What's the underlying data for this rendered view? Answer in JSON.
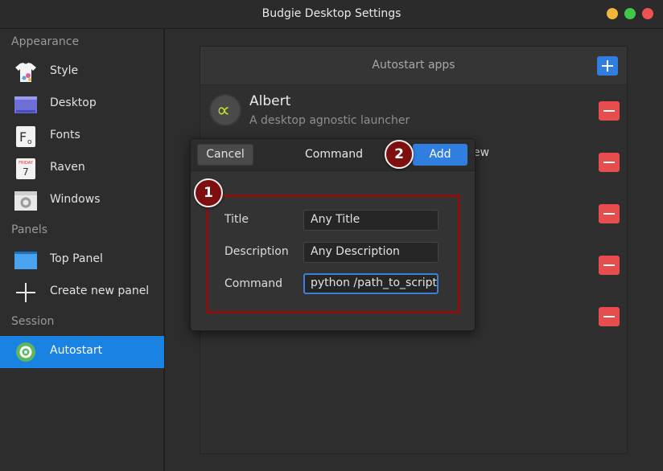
{
  "window": {
    "title": "Budgie Desktop Settings"
  },
  "colors": {
    "accent": "#1a82e2",
    "remove": "#e84d4d",
    "highlight": "#8b0f0f",
    "minimize": "#f2b63a",
    "maximize": "#3ec94a",
    "close": "#ee5252"
  },
  "sidebar": {
    "sections": [
      {
        "label": "Appearance"
      },
      {
        "label": "Panels"
      },
      {
        "label": "Session"
      }
    ],
    "items": [
      {
        "label": "Style",
        "icon": "shirt-icon"
      },
      {
        "label": "Desktop",
        "icon": "desktop-icon"
      },
      {
        "label": "Fonts",
        "icon": "fonts-icon"
      },
      {
        "label": "Raven",
        "icon": "calendar-icon"
      },
      {
        "label": "Windows",
        "icon": "window-gear-icon"
      },
      {
        "label": "Top Panel",
        "icon": "panel-icon"
      },
      {
        "label": "Create new panel",
        "icon": "plus-icon"
      },
      {
        "label": "Autostart",
        "icon": "gear-icon",
        "active": true
      }
    ],
    "raven_icon": {
      "month": "FRIDAY",
      "day": "7"
    },
    "fonts_icon": {
      "glyph": "F",
      "sub": "o"
    }
  },
  "main": {
    "header_title": "Autostart apps",
    "apps": [
      {
        "name": "Albert",
        "description": "A desktop agnostic launcher"
      }
    ],
    "partial_text": "ew"
  },
  "dialog": {
    "cancel_label": "Cancel",
    "title": "Command",
    "add_label": "Add",
    "fields": [
      {
        "label": "Title",
        "value": "Any Title"
      },
      {
        "label": "Description",
        "value": "Any Description"
      },
      {
        "label": "Command",
        "value": "python /path_to_script."
      }
    ]
  },
  "annotations": {
    "badge1": "1",
    "badge2": "2"
  }
}
